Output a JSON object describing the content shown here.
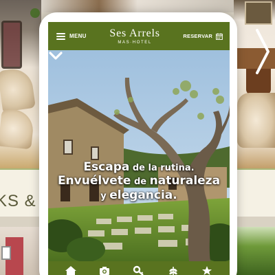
{
  "background": {
    "band_text": "KS &"
  },
  "header": {
    "menu_label": "MENU",
    "logo_name": "Ses Arrels",
    "logo_sub": "MAS·HOTEL",
    "reserve_label": "RESERVAR",
    "menu_icon": "hamburger-icon",
    "reserve_icon": "calendar-icon"
  },
  "hero": {
    "line1_strong": "Escapa",
    "line1_rest": " de la rutina.",
    "line2_strong_a": "Envuélvete",
    "line2_mid": " de ",
    "line2_strong_b": "naturaleza",
    "line3_mid": "y ",
    "line3_strong": "elegancia.",
    "scroll_icon": "chevron-down-icon"
  },
  "bottom_nav": {
    "items": [
      "home-icon",
      "camera-icon",
      "key-icon",
      "leaf-icon",
      "star-icon"
    ]
  },
  "colors": {
    "brand_green": "#59731f",
    "band_bg": "#f5f1e4"
  }
}
